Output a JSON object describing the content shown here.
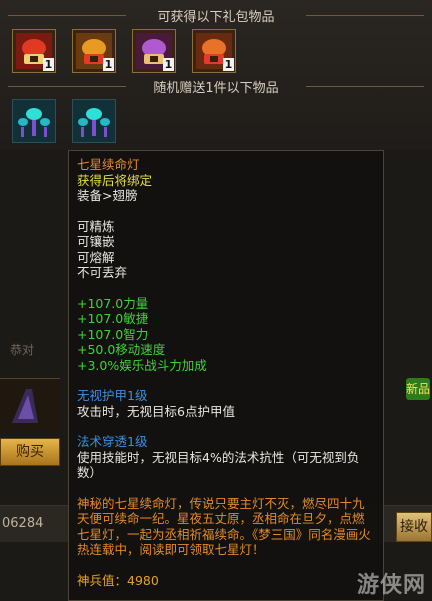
{
  "rewards": {
    "header_gift": "可获得以下礼包物品",
    "header_random": "随机赠送1件以下物品",
    "gift_items": [
      {
        "icon": "red-lantern-chest-icon",
        "count": "1"
      },
      {
        "icon": "gold-lantern-chest-icon",
        "count": "1"
      },
      {
        "icon": "purple-lantern-chest-icon",
        "count": "1"
      },
      {
        "icon": "orange-lantern-chest-icon",
        "count": "1"
      }
    ],
    "random_items": [
      {
        "icon": "teal-lantern-wings-icon"
      },
      {
        "icon": "teal-lantern-wings-icon"
      }
    ]
  },
  "background": {
    "buy_label": "购买",
    "value": "06284",
    "receive_label": "接收",
    "new_badge": "新品",
    "side_text": "恭对"
  },
  "tooltip": {
    "name": "七星续命灯",
    "bind": "获得后将绑定",
    "category": "装备>翅膀",
    "props": [
      "可精炼",
      "可镶嵌",
      "可熔解",
      "不可丢弃"
    ],
    "stats": [
      "+107.0力量",
      "+107.0敏捷",
      "+107.0智力",
      "+50.0移动速度",
      "+3.0%娱乐战斗力加成"
    ],
    "skill1_name": "无视护甲1级",
    "skill1_desc": "攻击时，无视目标6点护甲值",
    "skill2_name": "法术穿透1级",
    "skill2_desc": "使用技能时，无视目标4%的法术抗性（可无视到负数）",
    "lore": "神秘的七星续命灯，传说只要主灯不灭，燃尽四十九天便可续命一纪。星夜五丈原，丞相命在旦夕，点燃七星灯，一起为丞相祈福续命。《梦三国》同名漫画火热连载中，阅读即可领取七星灯！",
    "weapon_value": "神兵值：4980"
  },
  "watermark": "游侠网"
}
